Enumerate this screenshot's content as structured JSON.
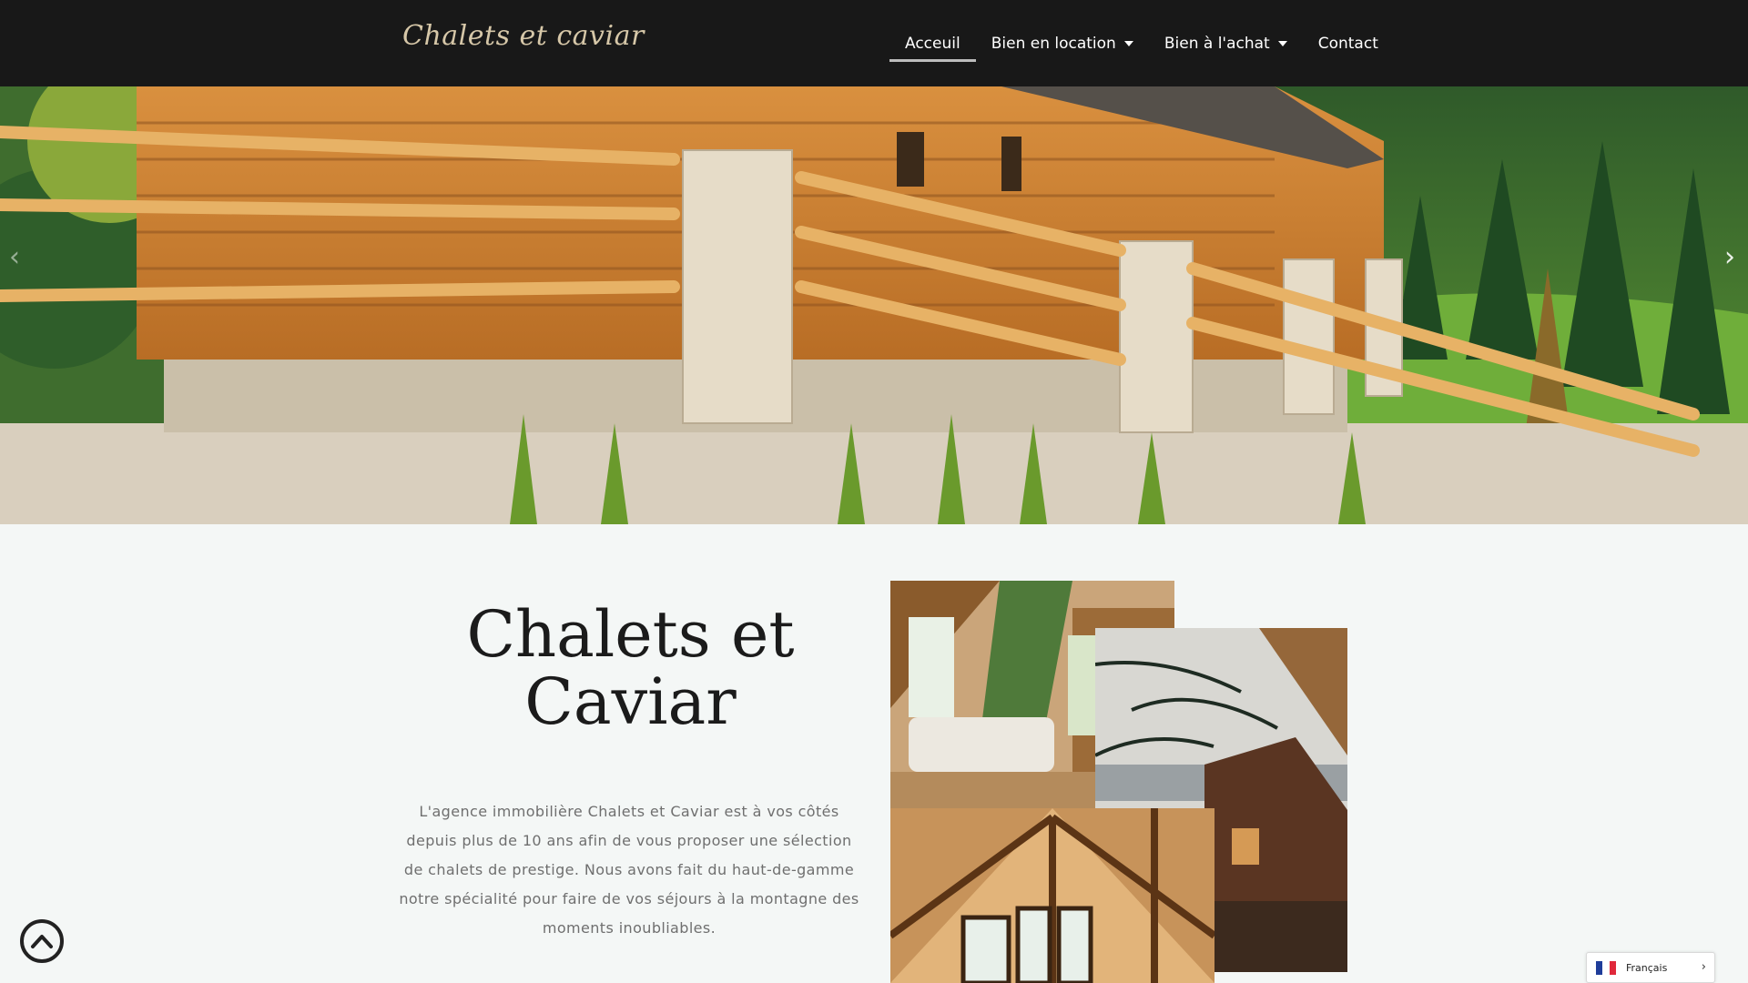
{
  "header": {
    "logo_text": "Chalets et caviar",
    "nav": [
      {
        "label": "Acceuil",
        "active": true,
        "has_dropdown": false
      },
      {
        "label": "Bien en location",
        "active": false,
        "has_dropdown": true
      },
      {
        "label": "Bien à l'achat",
        "active": false,
        "has_dropdown": true
      },
      {
        "label": "Contact",
        "active": false,
        "has_dropdown": false
      }
    ]
  },
  "hero": {
    "prev_arrow": "‹",
    "next_arrow": "›"
  },
  "intro": {
    "title": "Chalets et Caviar",
    "text": "L'agence immobilière Chalets et Caviar est à vos côtés depuis plus de 10 ans afin de vous proposer une sélection de chalets de prestige. Nous avons fait du haut-de-gamme notre spécialité pour faire de vos séjours à la montagne des moments inoubliables."
  },
  "language": {
    "label": "Français",
    "arrow": "›",
    "flag_colors": [
      "#1f3d9a",
      "#ffffff",
      "#e0283b"
    ]
  },
  "colors": {
    "header_bg": "#181818",
    "page_bg": "#f4f7f6",
    "logo": "#d6c7a8"
  }
}
